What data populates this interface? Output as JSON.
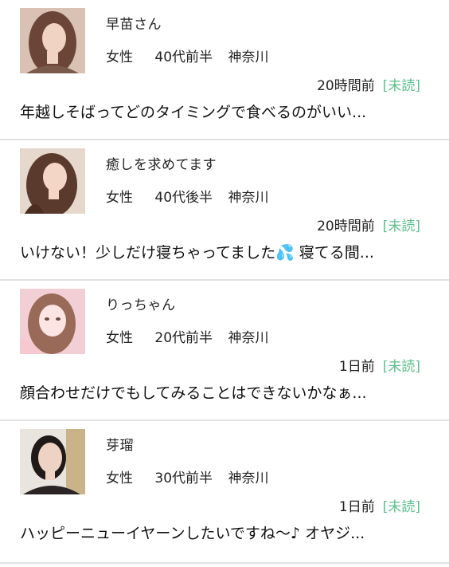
{
  "messages": [
    {
      "name": "早苗さん",
      "gender": "女性",
      "age": "40代前半",
      "location": "神奈川",
      "time": "20時間前",
      "status": "[未読]",
      "preview": "年越しそばってどのタイミングで食べるのがいい...",
      "avatar_icon": "woman-portrait-brown-hair",
      "avatar_colors": [
        "#d9c2b4",
        "#6b4638",
        "#f1d3c3"
      ]
    },
    {
      "name": "癒しを求めてます",
      "gender": "女性",
      "age": "40代後半",
      "location": "神奈川",
      "time": "20時間前",
      "status": "[未読]",
      "preview": "いけない！少しだけ寝ちゃってました💦 寝てる間...",
      "avatar_icon": "woman-portrait-wavy-hair",
      "avatar_colors": [
        "#e6d8cc",
        "#5a3a2c",
        "#f3d6c6"
      ]
    },
    {
      "name": "りっちゃん",
      "gender": "女性",
      "age": "20代前半",
      "location": "神奈川",
      "time": "1日前",
      "status": "[未読]",
      "preview": "顔合わせだけでもしてみることはできないかなぁ...",
      "avatar_icon": "woman-portrait-pink-filter",
      "avatar_colors": [
        "#f2cfd4",
        "#9a6a58",
        "#fbe4e2"
      ]
    },
    {
      "name": "芽瑠",
      "gender": "女性",
      "age": "30代前半",
      "location": "神奈川",
      "time": "1日前",
      "status": "[未読]",
      "preview": "ハッピーニューイヤーンしたいですね～♪ オヤジ...",
      "avatar_icon": "woman-portrait-dark-hair",
      "avatar_colors": [
        "#e9e4de",
        "#1f1a18",
        "#eed2c4"
      ]
    }
  ]
}
